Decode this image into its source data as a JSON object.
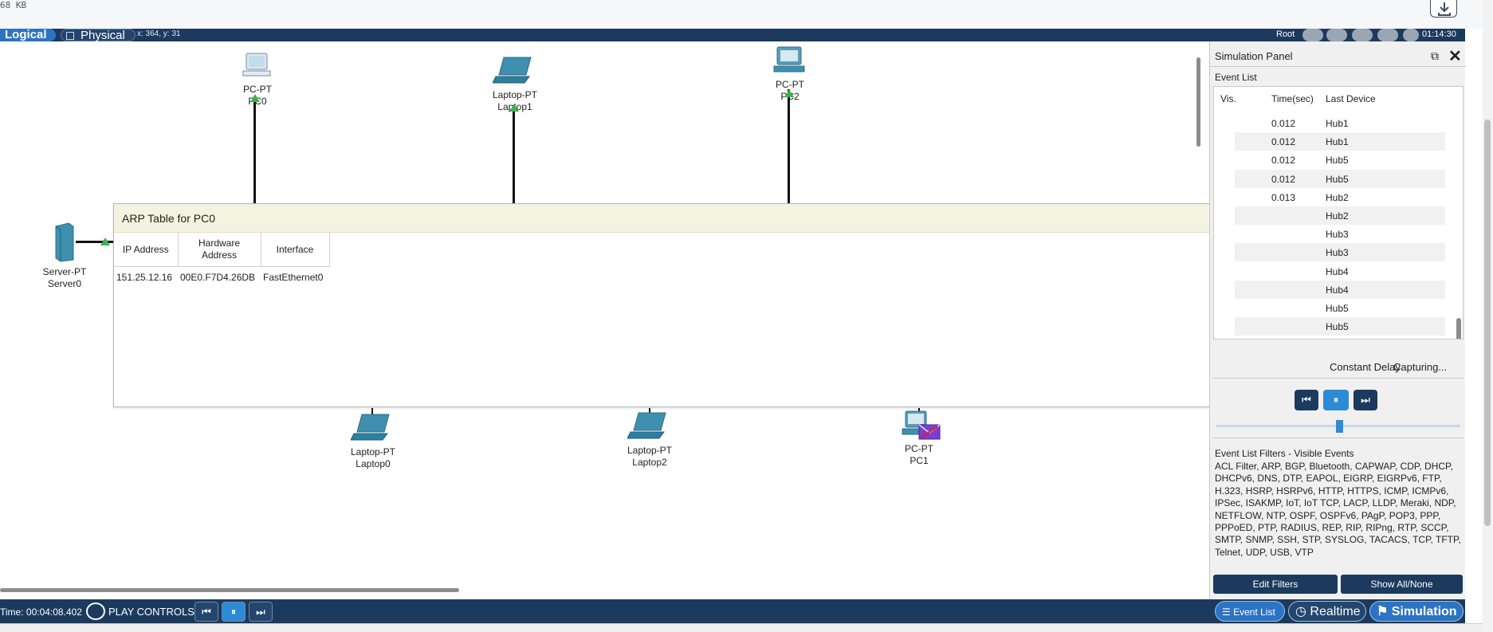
{
  "file": {
    "size_label": "68 KB"
  },
  "toolbar": {
    "tab_logical": "Logical",
    "tab_physical": "Physical",
    "coords": "x: 364, y: 31",
    "root": "Root",
    "clock": "01:14:30"
  },
  "devices": {
    "pc0": {
      "type": "PC-PT",
      "name": "PC0"
    },
    "laptop1": {
      "type": "Laptop-PT",
      "name": "Laptop1"
    },
    "pc2": {
      "type": "PC-PT",
      "name": "PC2"
    },
    "server0": {
      "type": "Server-PT",
      "name": "Server0"
    },
    "laptop0": {
      "type": "Laptop-PT",
      "name": "Laptop0"
    },
    "laptop2": {
      "type": "Laptop-PT",
      "name": "Laptop2"
    },
    "pc1": {
      "type": "PC-PT",
      "name": "PC1"
    }
  },
  "arp_dialog": {
    "title": "ARP Table for PC0",
    "close": "×",
    "columns": [
      "IP Address",
      "Hardware Address",
      "Interface"
    ],
    "rows": [
      {
        "ip": "151.25.12.16",
        "mac": "00E0.F7D4.26DB",
        "iface": "FastEthernet0"
      }
    ]
  },
  "sim_panel": {
    "title": "Simulation Panel",
    "event_list_label": "Event List",
    "headers": {
      "vis": "Vis.",
      "time": "Time(sec)",
      "device": "Last Device"
    },
    "events": [
      {
        "time": "0.012",
        "device": "Hub1"
      },
      {
        "time": "0.012",
        "device": "Hub1"
      },
      {
        "time": "0.012",
        "device": "Hub5"
      },
      {
        "time": "0.012",
        "device": "Hub5"
      },
      {
        "time": "0.013",
        "device": "Hub2"
      },
      {
        "time": "",
        "device": "Hub2"
      },
      {
        "time": "",
        "device": "Hub3"
      },
      {
        "time": "",
        "device": "Hub3"
      },
      {
        "time": "",
        "device": "Hub4"
      },
      {
        "time": "",
        "device": "Hub4"
      },
      {
        "time": "",
        "device": "Hub5"
      },
      {
        "time": "",
        "device": "Hub5"
      }
    ],
    "constant_delay": "Constant Delay",
    "capturing": "Capturing...",
    "filters_label": "Event List Filters - Visible Events",
    "filters_text": "ACL Filter, ARP, BGP, Bluetooth, CAPWAP, CDP, DHCP, DHCPv6, DNS, DTP, EAPOL, EIGRP, EIGRPv6, FTP, H.323, HSRP, HSRPv6, HTTP, HTTPS, ICMP, ICMPv6, IPSec, ISAKMP, IoT, IoT TCP, LACP, LLDP, Meraki, NDP, NETFLOW, NTP, OSPF, OSPFv6, PAgP, POP3, PPP, PPPoED, PTP, RADIUS, REP, RIP, RIPng, RTP, SCCP, SMTP, SNMP, SSH, STP, SYSLOG, TACACS, TCP, TFTP, Telnet, UDP, USB, VTP",
    "edit_filters": "Edit Filters",
    "show_all_none": "Show All/None"
  },
  "bottom": {
    "time": "Time: 00:04:08.402",
    "play_controls": "PLAY CONTROLS:",
    "event_list": "Event List",
    "realtime": "Realtime",
    "simulation": "Simulation"
  },
  "colors": {
    "navy": "#1c3a5e",
    "accent_blue": "#2d8ad6",
    "close_red": "#d43b3b",
    "link_up_green": "#3cb44b"
  }
}
